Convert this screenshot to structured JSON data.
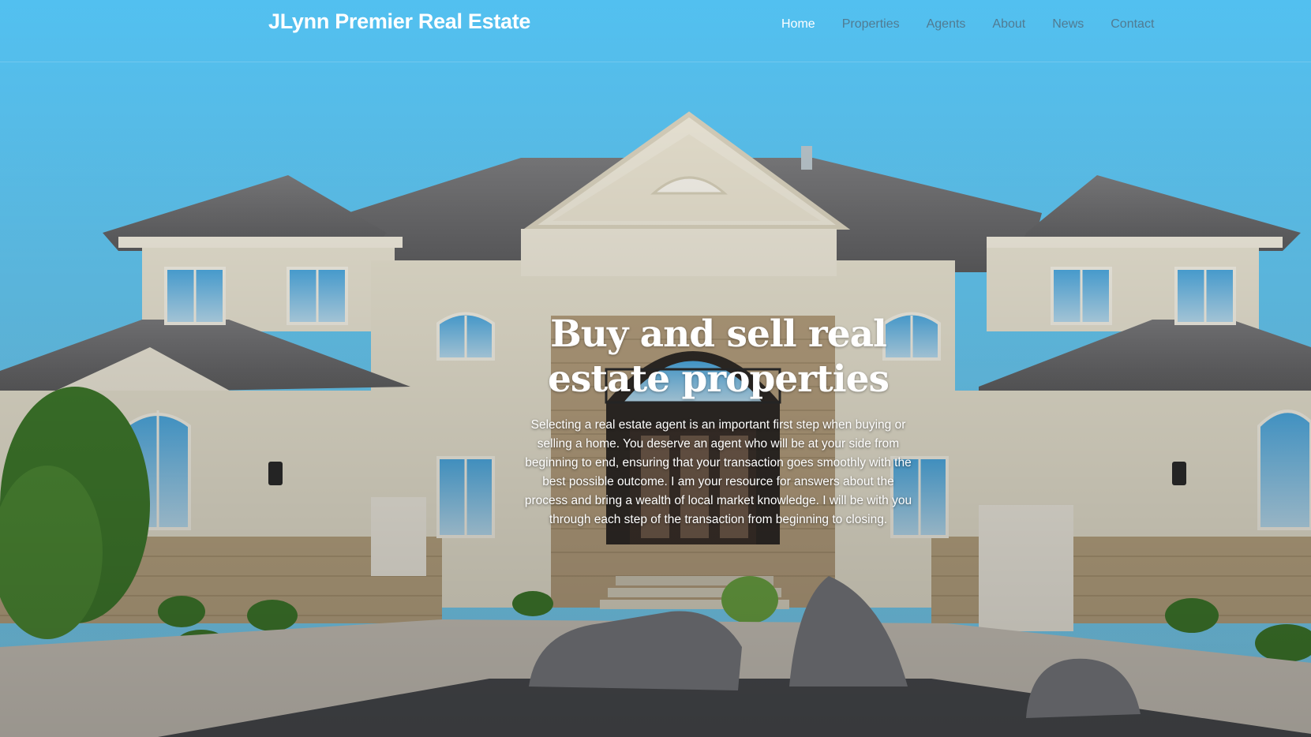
{
  "header": {
    "brand": "JLynn Premier Real Estate",
    "nav": [
      {
        "label": "Home",
        "active": true
      },
      {
        "label": "Properties",
        "active": false
      },
      {
        "label": "Agents",
        "active": false
      },
      {
        "label": "About",
        "active": false
      },
      {
        "label": "News",
        "active": false
      },
      {
        "label": "Contact",
        "active": false
      }
    ]
  },
  "hero": {
    "title": "Buy and sell real estate properties",
    "text": "Selecting a real estate agent is an important first step when buying or selling a home. You deserve an agent who will be at your side from beginning to end, ensuring that your transaction goes smoothly with the best possible outcome. I am your resource for answers about the process and bring a wealth of local market knowledge. I will be with you through each step of the transaction from beginning to closing."
  },
  "colors": {
    "sky": "#5cc6f2",
    "nav_text": "#6f8494",
    "nav_active": "#ffffff",
    "stucco": "#e6e1cf",
    "roof": "#6b6b6d"
  }
}
